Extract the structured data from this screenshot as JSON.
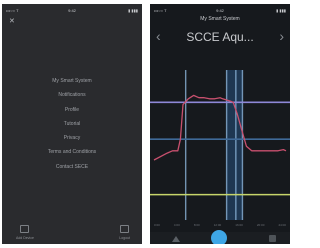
{
  "left_screen": {
    "status_left": "•••○○ T",
    "status_time": "9:42",
    "status_right": "▮ ▮▮▮",
    "close_icon": "close-icon",
    "menu_items": [
      "My Smart System",
      "Notifications",
      "Profile",
      "Tutorial",
      "Privacy",
      "Terms and Conditions",
      "Contact SECE"
    ],
    "bottom_actions": [
      {
        "icon": "device-icon",
        "label": "Add Device"
      },
      {
        "icon": "logout-icon",
        "label": "Logout"
      }
    ]
  },
  "right_screen": {
    "status_left": "•••○○ T",
    "status_time": "9:42",
    "status_right": "▮ ▮▮▮",
    "title": "My Smart System",
    "prev_arrow": "‹",
    "next_arrow": "›",
    "sensor_name": "SCCE Aqu...",
    "colors": {
      "trend": "#c8506e",
      "upper": "#8e88d8",
      "lower": "#c6d56a",
      "reference": "#3f6a98",
      "vertical": "#8bb3d8",
      "highlight": "#2f6fb8"
    },
    "chart_data": {
      "type": "line",
      "x": [
        0,
        10,
        14,
        18,
        20,
        22,
        26,
        30,
        34,
        38,
        42,
        46,
        50,
        52,
        55,
        58,
        60,
        63,
        66,
        70,
        74,
        78,
        82,
        86,
        90,
        94,
        98,
        100
      ],
      "series": [
        {
          "values": [
            32,
            38,
            40,
            40,
            50,
            80,
            85,
            88,
            86,
            86,
            85,
            85,
            86,
            85,
            84,
            83,
            82,
            72,
            60,
            44,
            40,
            40,
            40,
            40,
            40,
            40,
            41,
            40
          ]
        }
      ],
      "reference_lines": [
        82,
        50,
        2
      ],
      "vertical_markers": [
        24,
        55,
        62,
        67
      ],
      "ylim": [
        -20,
        110
      ],
      "x_ticks": [
        "0:00",
        "4:00",
        "8:00",
        "12:00",
        "16:00",
        "20:00",
        "24:00"
      ]
    },
    "bottom_icons": [
      "graph-icon",
      "add-button",
      "settings-icon"
    ]
  }
}
